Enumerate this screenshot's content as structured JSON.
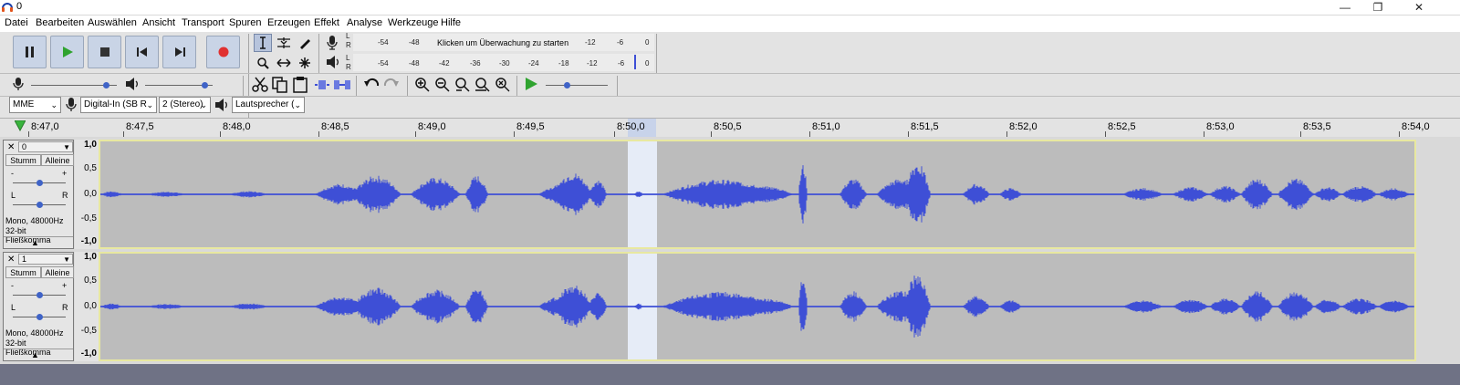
{
  "window": {
    "title": "0",
    "minimize": "—",
    "maximize": "❐",
    "close": "✕"
  },
  "menu": [
    "Datei",
    "Bearbeiten",
    "Auswählen",
    "Ansicht",
    "Transport",
    "Spuren",
    "Erzeugen",
    "Effekt",
    "Analyse",
    "Werkzeuge",
    "Hilfe"
  ],
  "meters": {
    "record_hint": "Klicken um Überwachung zu starten",
    "record_scale_left": [
      "-54",
      "-48"
    ],
    "record_scale_right": [
      "-12",
      "-6",
      "0"
    ],
    "play_scale": [
      "-54",
      "-48",
      "-42",
      "-36",
      "-30",
      "-24",
      "-18",
      "-12",
      "-6",
      "0"
    ],
    "channel_l": "L",
    "channel_r": "R"
  },
  "device": {
    "host": "MME",
    "input": "Digital-In (SB R",
    "channels": "2 (Stereo)",
    "output": "Lautsprecher ("
  },
  "ruler": {
    "labels": [
      "8:47,0",
      "8:47,5",
      "8:48,0",
      "8:48,5",
      "8:49,0",
      "8:49,5",
      "8:50,0",
      "8:50,5",
      "8:51,0",
      "8:51,5",
      "8:52,0",
      "8:52,5",
      "8:53,0",
      "8:53,5",
      "8:54,0"
    ]
  },
  "tracks": [
    {
      "name": "0",
      "mute": "Stumm",
      "solo": "Alleine",
      "gain_minus": "-",
      "gain_plus": "+",
      "pan_l": "L",
      "pan_r": "R",
      "info1": "Mono, 48000Hz",
      "info2": "32-bit Fließkomma",
      "scale": [
        "1,0",
        "0,5",
        "0,0",
        "-0,5",
        "-1,0"
      ]
    },
    {
      "name": "1",
      "mute": "Stumm",
      "solo": "Alleine",
      "gain_minus": "-",
      "gain_plus": "+",
      "pan_l": "L",
      "pan_r": "R",
      "info1": "Mono, 48000Hz",
      "info2": "32-bit Fließkomma",
      "scale": [
        "1,0",
        "0,5",
        "0,0",
        "-0,5",
        "-1,0"
      ]
    }
  ],
  "colors": {
    "waveform": "#3e4fd6",
    "wave_bg": "#bcbcbc",
    "selection": "#e6ecf7",
    "accent_record": "#e03131",
    "play_green": "#2fa32f"
  }
}
